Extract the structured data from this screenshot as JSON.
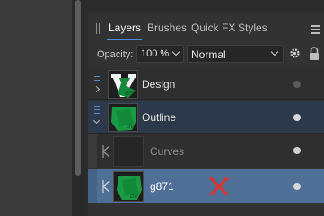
{
  "panel": {
    "tabs": [
      {
        "label": "Layers",
        "active": true
      },
      {
        "label": "Brushes",
        "active": false
      },
      {
        "label": "Quick FX",
        "active": false
      },
      {
        "label": "Styles",
        "active": false
      }
    ],
    "opacity_label": "Opacity:",
    "opacity_value": "100 %",
    "blend_mode": "Normal",
    "accent_color": "#4d8ee0",
    "selected_row_color": "#4f6f96"
  },
  "layers": [
    {
      "name": "Design",
      "thumbnail": "vim-logo-thumbnail",
      "expanded": false,
      "visible_dot": "dim"
    },
    {
      "name": "Outline",
      "thumbnail": "green-shape-thumbnail",
      "expanded": true,
      "visible_dot": "on"
    },
    {
      "name": "Curves",
      "thumbnail": "empty-thumbnail",
      "child": true,
      "visible_dot": "on"
    },
    {
      "name": "g871",
      "thumbnail": "green-shape-thumbnail",
      "child": true,
      "selected": true,
      "visible_dot": "on"
    }
  ]
}
